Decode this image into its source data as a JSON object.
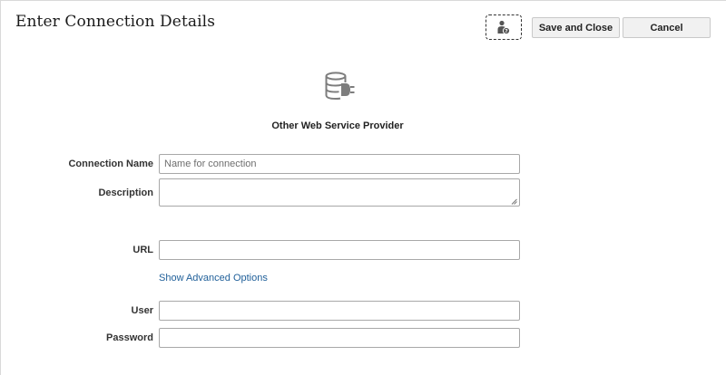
{
  "header": {
    "title": "Enter Connection Details",
    "help_icon": "help-person-icon",
    "save_label": "Save and Close",
    "cancel_label": "Cancel"
  },
  "provider": {
    "icon": "database-plug-icon",
    "name": "Other Web Service Provider"
  },
  "form": {
    "connection_name": {
      "label": "Connection Name",
      "value": "",
      "placeholder": "Name for connection"
    },
    "description": {
      "label": "Description",
      "value": ""
    },
    "url": {
      "label": "URL",
      "value": ""
    },
    "advanced_link": "Show Advanced Options",
    "user": {
      "label": "User",
      "value": ""
    },
    "password": {
      "label": "Password",
      "value": ""
    }
  },
  "colors": {
    "link": "#1f5f99",
    "button_bg": "#f1f1f1",
    "field_border": "#a8a8a8",
    "icon_gray": "#808080"
  }
}
